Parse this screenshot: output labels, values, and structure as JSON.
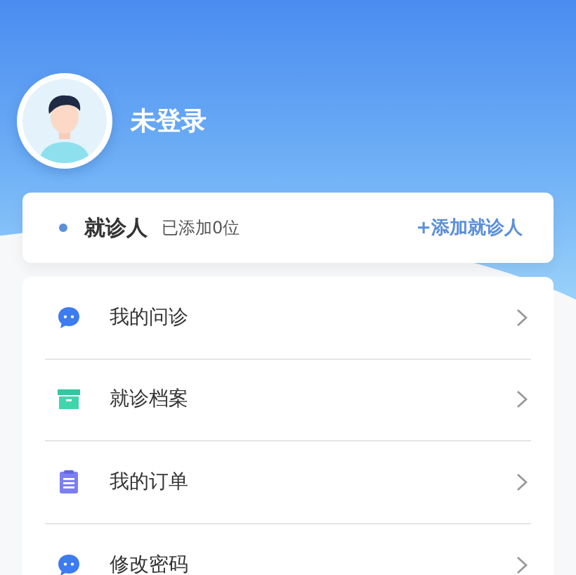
{
  "profile": {
    "name": "未登录"
  },
  "patients": {
    "label": "就诊人",
    "count": "已添加0位",
    "add_link": "+添加就诊人"
  },
  "menu": [
    {
      "label": "我的问诊",
      "kind": "chat"
    },
    {
      "label": "就诊档案",
      "kind": "archive"
    },
    {
      "label": "我的订单",
      "kind": "clipboard"
    },
    {
      "label": "修改密码",
      "kind": "chat"
    }
  ]
}
